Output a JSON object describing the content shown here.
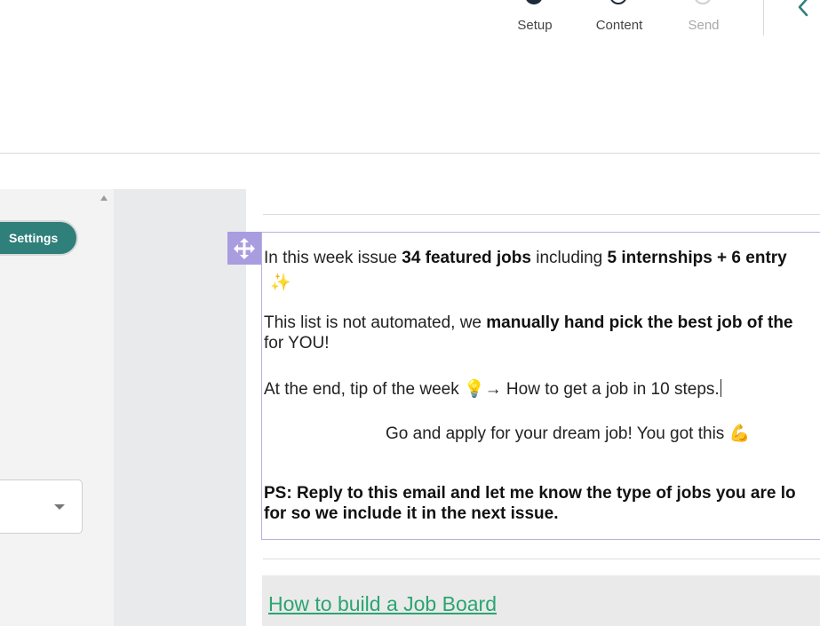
{
  "stepper": {
    "steps": [
      {
        "label": "Setup",
        "state": "complete"
      },
      {
        "label": "Content",
        "state": "current"
      },
      {
        "label": "Send",
        "state": "upcoming"
      }
    ]
  },
  "sidebar": {
    "settings_label": "Settings",
    "select_value": ""
  },
  "editor": {
    "line1_a": "In this week issue ",
    "line1_b": "34 featured jobs",
    "line1_c": " including ",
    "line1_d": "5 internships + 6 entry",
    "line2_emoji": "✨",
    "line3_a": "This list is not automated, we ",
    "line3_b": "manually hand pick the best job of the",
    "line4": "for YOU!",
    "line5": "At the end, tip of the week 💡→ How to get a job in 10 steps.",
    "line6": "Go and apply for your dream job! You got this 💪",
    "line7": "PS: Reply to this email and let me know the type of jobs you are lo",
    "line8": "for so we include it in the next issue.",
    "link_text": "How to build a Job Board"
  },
  "colors": {
    "accent": "#2f7f7b",
    "handle": "#a99de0",
    "link": "#2aa571",
    "stepper_dark": "#1d2b3a"
  },
  "icons": {
    "back": "chevron-left-icon",
    "move": "move-arrows-icon",
    "select_caret": "caret-down-icon",
    "scroll_up": "scroll-up-arrow-icon"
  }
}
